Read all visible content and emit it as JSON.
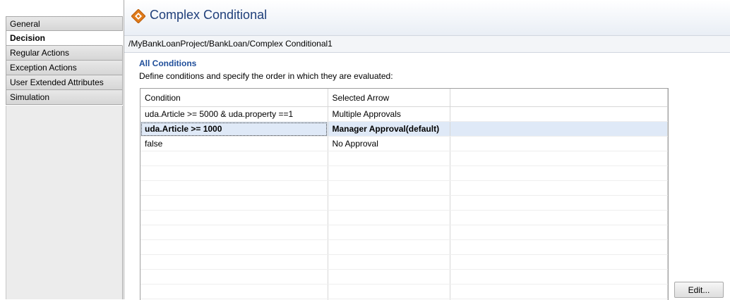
{
  "sidebar": {
    "tabs": [
      {
        "label": "General",
        "active": false
      },
      {
        "label": "Decision",
        "active": true
      },
      {
        "label": "Regular Actions",
        "active": false
      },
      {
        "label": "Exception Actions",
        "active": false
      },
      {
        "label": "User Extended Attributes",
        "active": false
      },
      {
        "label": "Simulation",
        "active": false
      }
    ]
  },
  "header": {
    "title": "Complex Conditional",
    "title_icon": "decision-diamond-icon",
    "path": "/MyBankLoanProject/BankLoan/Complex Conditional1"
  },
  "section": {
    "title": "All Conditions",
    "description": "Define conditions and specify the order in which they are evaluated:"
  },
  "table": {
    "columns": [
      "Condition",
      "Selected Arrow",
      ""
    ],
    "rows": [
      {
        "condition": "uda.Article >= 5000 & uda.property ==1",
        "arrow": "Multiple Approvals"
      },
      {
        "condition": "uda.Article >= 1000",
        "arrow": "Manager Approval(default)",
        "selected": true
      },
      {
        "condition": "false",
        "arrow": "No Approval"
      }
    ]
  },
  "buttons": {
    "edit": "Edit..."
  },
  "colors": {
    "title": "#1f3f7a",
    "icon": "#e07b1a",
    "selection": "#dfe9f7"
  }
}
